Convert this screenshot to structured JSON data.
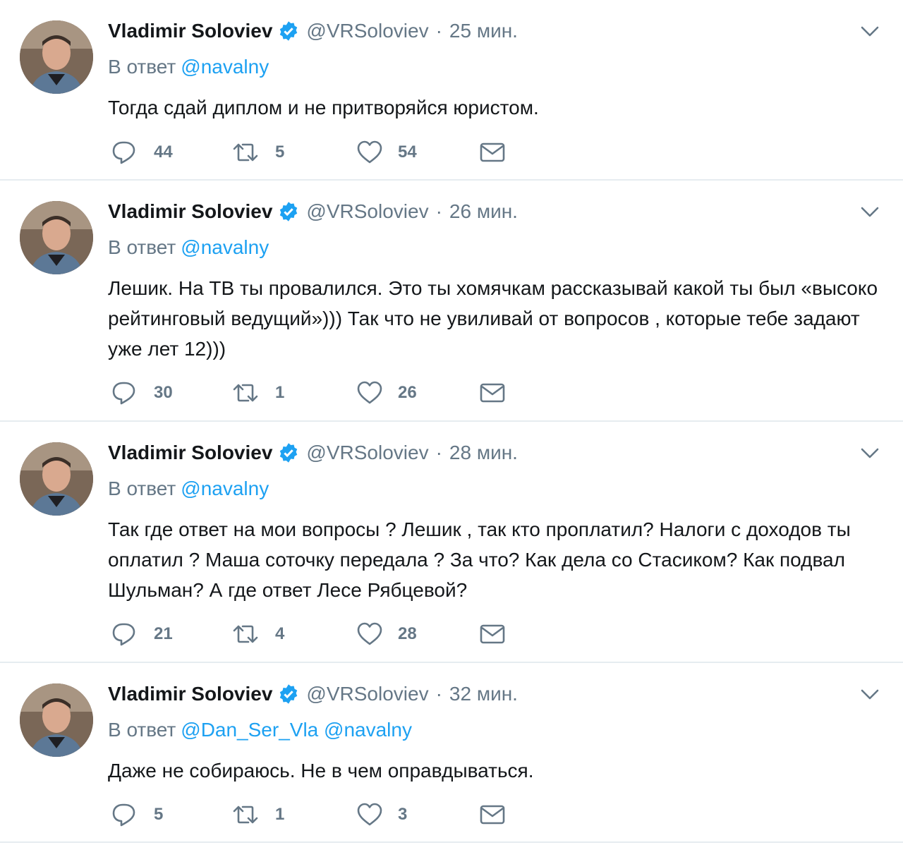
{
  "colors": {
    "link": "#1da1f2",
    "secondary": "#657786",
    "text": "#14171a",
    "divider": "#e6ecf0"
  },
  "tweets": [
    {
      "author_name": "Vladimir Soloviev",
      "handle": "@VRSoloviev",
      "separator": "·",
      "time": "25 мин.",
      "reply_prefix": "В ответ",
      "reply_mentions": "@navalny",
      "text": "Тогда сдай диплом и не притворяйся юристом.",
      "replies": "44",
      "retweets": "5",
      "likes": "54",
      "icons": [
        "avatar",
        "verified-icon",
        "chevron-down-icon",
        "reply-icon",
        "retweet-icon",
        "heart-icon",
        "mail-icon"
      ]
    },
    {
      "author_name": "Vladimir Soloviev",
      "handle": "@VRSoloviev",
      "separator": "·",
      "time": "26 мин.",
      "reply_prefix": "В ответ",
      "reply_mentions": "@navalny",
      "text": "Лешик.  На ТВ ты провалился. Это ты хомячкам рассказывай какой ты был «высоко рейтинговый ведущий»))) Так что не увиливай от вопросов , которые тебе задают уже лет 12)))",
      "replies": "30",
      "retweets": "1",
      "likes": "26"
    },
    {
      "author_name": "Vladimir Soloviev",
      "handle": "@VRSoloviev",
      "separator": "·",
      "time": "28 мин.",
      "reply_prefix": "В ответ",
      "reply_mentions": "@navalny",
      "text": "Так где ответ на мои вопросы ? Лешик , так кто проплатил? Налоги с доходов ты оплатил ? Маша соточку передала ? За что? Как дела со Стасиком? Как подвал Шульман? А где ответ Лесе Рябцевой?",
      "replies": "21",
      "retweets": "4",
      "likes": "28"
    },
    {
      "author_name": "Vladimir Soloviev",
      "handle": "@VRSoloviev",
      "separator": "·",
      "time": "32 мин.",
      "reply_prefix": "В ответ",
      "reply_mentions": "@Dan_Ser_Vla @navalny",
      "text": "Даже не собираюсь. Не в чем оправдываться.",
      "replies": "5",
      "retweets": "1",
      "likes": "3"
    }
  ]
}
